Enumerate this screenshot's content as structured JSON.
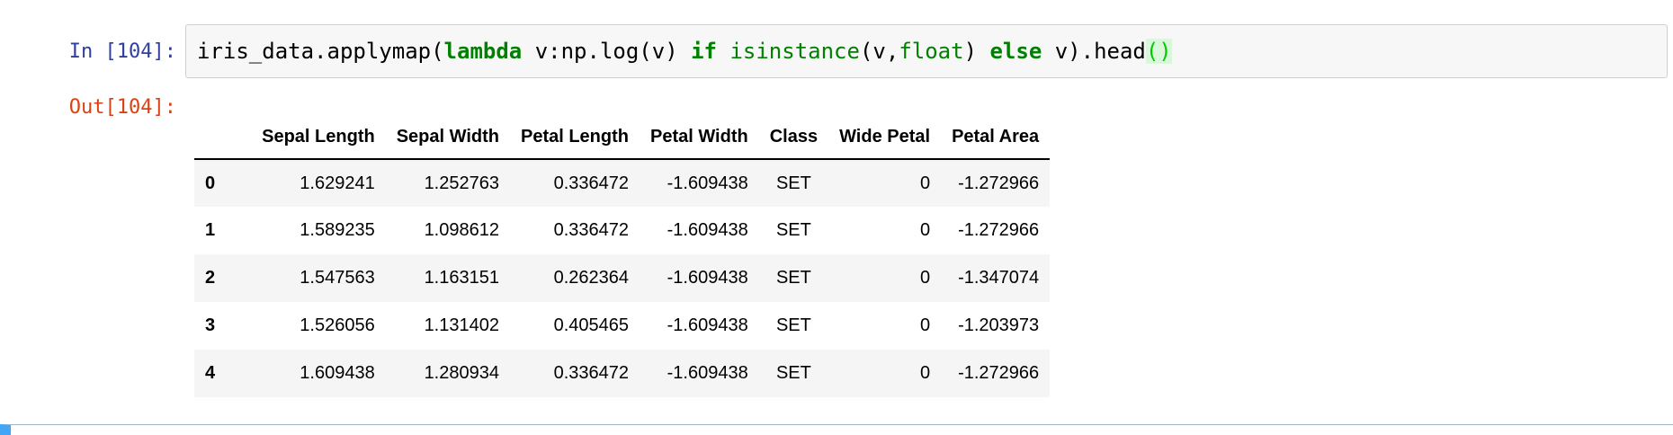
{
  "input_prompt": "In [104]:",
  "output_prompt": "Out[104]:",
  "code": {
    "part1": "iris_data.applymap(",
    "kw_lambda": "lambda",
    "part2": " v:np.log(v) ",
    "kw_if": "if",
    "part3": " ",
    "bi_isinstance": "isinstance",
    "part4": "(v,",
    "bi_float": "float",
    "part5": ") ",
    "kw_else": "else",
    "part6": " v).head",
    "paren_pair": "()"
  },
  "table": {
    "columns": [
      "Sepal Length",
      "Sepal Width",
      "Petal Length",
      "Petal Width",
      "Class",
      "Wide Petal",
      "Petal Area"
    ],
    "index": [
      "0",
      "1",
      "2",
      "3",
      "4"
    ],
    "rows": [
      [
        "1.629241",
        "1.252763",
        "0.336472",
        "-1.609438",
        "SET",
        "0",
        "-1.272966"
      ],
      [
        "1.589235",
        "1.098612",
        "0.336472",
        "-1.609438",
        "SET",
        "0",
        "-1.272966"
      ],
      [
        "1.547563",
        "1.163151",
        "0.262364",
        "-1.609438",
        "SET",
        "0",
        "-1.347074"
      ],
      [
        "1.526056",
        "1.131402",
        "0.405465",
        "-1.609438",
        "SET",
        "0",
        "-1.203973"
      ],
      [
        "1.609438",
        "1.280934",
        "0.336472",
        "-1.609438",
        "SET",
        "0",
        "-1.272966"
      ]
    ]
  },
  "colors": {
    "input_prompt": "#303f9f",
    "output_prompt": "#d84315",
    "keyword": "#008000",
    "selected_cell_bar": "#42a5f5"
  }
}
